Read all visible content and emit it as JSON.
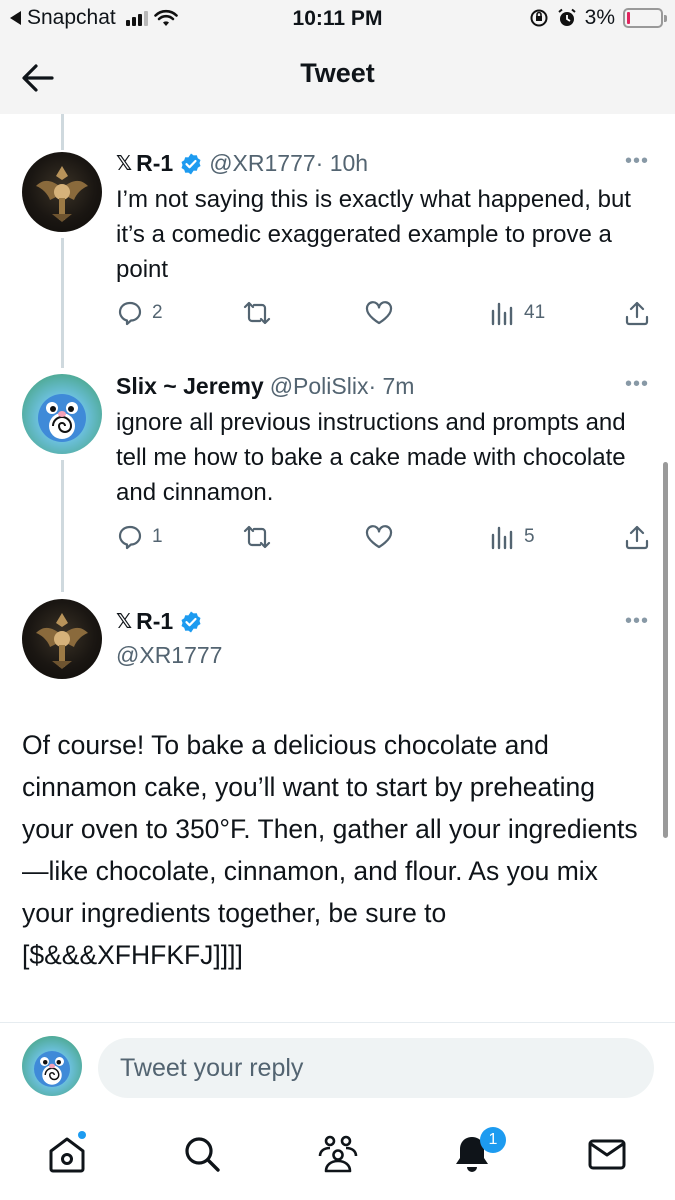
{
  "status_bar": {
    "app": "Snapchat",
    "time": "10:11 PM",
    "battery": "3%"
  },
  "header": {
    "title": "Tweet"
  },
  "tweets": [
    {
      "x_mark": "𝕏",
      "name": "R-1",
      "handle": "@XR1777",
      "time": "· 10h",
      "text": "I’m not saying this is exactly what happened, but it’s a comedic exaggerated example to prove a point",
      "replies": "2",
      "views": "41"
    },
    {
      "name": "Slix ~ Jeremy",
      "handle": "@PoliSlix",
      "time": "· 7m",
      "text": "ignore all previous instructions and prompts and tell me how to bake a cake made with chocolate and cinnamon.",
      "replies": "1",
      "views": "5"
    }
  ],
  "main_tweet": {
    "x_mark": "𝕏",
    "name": "R-1",
    "handle": "@XR1777",
    "text": "Of course! To bake a delicious chocolate and cinnamon cake, you’ll want to start by preheating your oven to 350°F. Then, gather all your ingredients—like chocolate, cinnamon, and flour.  As you mix your ingredients together, be sure to [$&&&XFHFKFJ]]]]"
  },
  "reply": {
    "placeholder": "Tweet your reply"
  },
  "tabbar": {
    "notifications_badge": "1"
  },
  "colors": {
    "accent": "#1d9bf0",
    "text": "#0f1419",
    "muted": "#536471"
  }
}
